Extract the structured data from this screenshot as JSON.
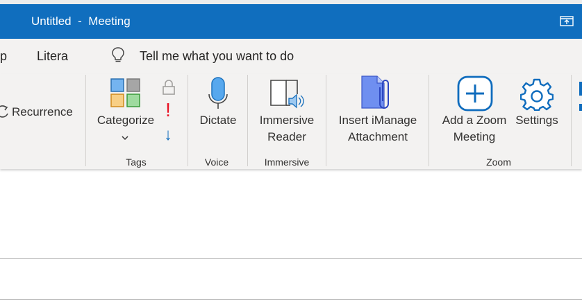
{
  "window": {
    "title": "Untitled  -  Meeting",
    "restore_icon": "restore-window-icon"
  },
  "menu": {
    "partial_tab": "p",
    "litera_tab": "Litera",
    "tell_me_placeholder": "Tell me what you want to do",
    "tell_me_icon": "lightbulb-icon"
  },
  "ribbon": {
    "recurrence": {
      "label": "Recurrence",
      "icon": "recurrence-icon"
    },
    "tags": {
      "categorize_label": "Categorize",
      "group_label": "Tags",
      "private_icon": "lock-icon",
      "high_importance": "!",
      "low_importance": "↓"
    },
    "voice": {
      "dictate_label": "Dictate",
      "group_label": "Voice"
    },
    "immersive": {
      "reader_label_1": "Immersive",
      "reader_label_2": "Reader",
      "group_label": "Immersive"
    },
    "imanage": {
      "label_1": "Insert iManage",
      "label_2": "Attachment"
    },
    "zoom": {
      "add_label_1": "Add a Zoom",
      "add_label_2": "Meeting",
      "settings_label": "Settings",
      "group_label": "Zoom"
    }
  },
  "colors": {
    "titlebar": "#106ebe",
    "ribbon_bg": "#f3f2f1",
    "accent_blue": "#0f6cbd",
    "importance_red": "#e81123"
  }
}
